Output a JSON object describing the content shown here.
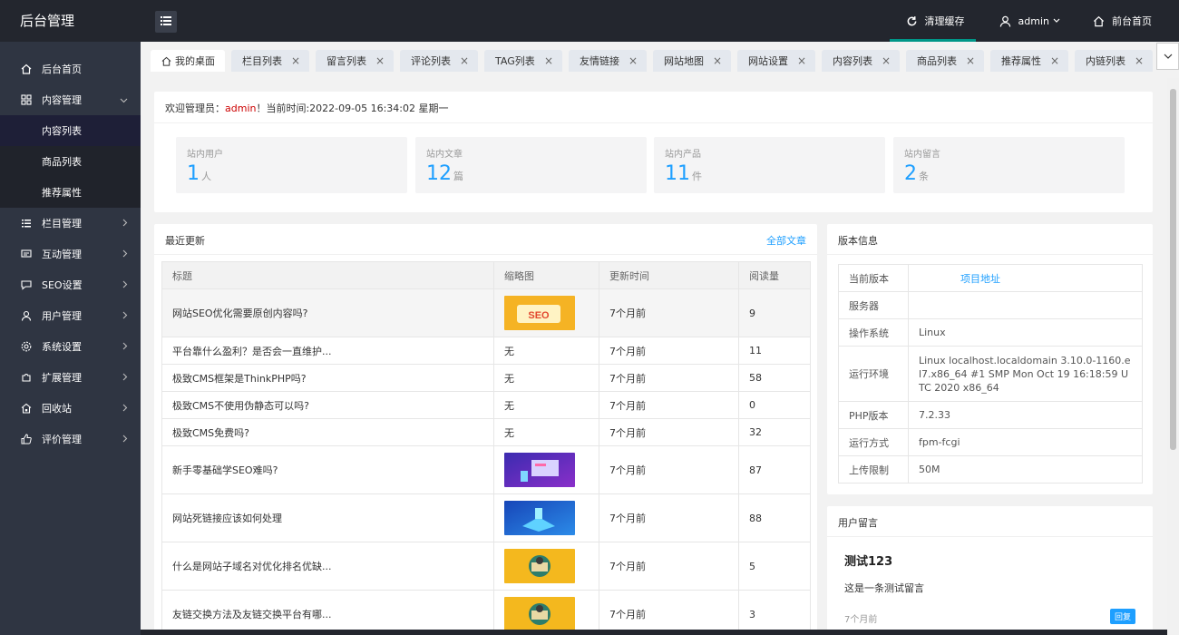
{
  "header": {
    "logo": "后台管理",
    "clear_cache": "清理缓存",
    "user": "admin",
    "front_home": "前台首页"
  },
  "sidebar": {
    "items": [
      {
        "label": "后台首页"
      },
      {
        "label": "内容管理"
      },
      {
        "label": "栏目管理"
      },
      {
        "label": "互动管理"
      },
      {
        "label": "SEO设置"
      },
      {
        "label": "用户管理"
      },
      {
        "label": "系统设置"
      },
      {
        "label": "扩展管理"
      },
      {
        "label": "回收站"
      },
      {
        "label": "评价管理"
      }
    ],
    "sub_items": [
      {
        "label": "内容列表"
      },
      {
        "label": "商品列表"
      },
      {
        "label": "推荐属性"
      }
    ]
  },
  "tabs": [
    {
      "label": "我的桌面"
    },
    {
      "label": "栏目列表"
    },
    {
      "label": "留言列表"
    },
    {
      "label": "评论列表"
    },
    {
      "label": "TAG列表"
    },
    {
      "label": "友情链接"
    },
    {
      "label": "网站地图"
    },
    {
      "label": "网站设置"
    },
    {
      "label": "内容列表"
    },
    {
      "label": "商品列表"
    },
    {
      "label": "推荐属性"
    },
    {
      "label": "内链列表"
    }
  ],
  "welcome": {
    "prefix": "欢迎管理员：",
    "admin": "admin",
    "suffix": "！当前时间:2022-09-05 16:34:02 星期一"
  },
  "stats": [
    {
      "label": "站内用户",
      "value": "1",
      "unit": "人"
    },
    {
      "label": "站内文章",
      "value": "12",
      "unit": "篇"
    },
    {
      "label": "站内产品",
      "value": "11",
      "unit": "件"
    },
    {
      "label": "站内留言",
      "value": "2",
      "unit": "条"
    }
  ],
  "recent": {
    "title": "最近更新",
    "all_link": "全部文章",
    "headers": [
      "标题",
      "缩略图",
      "更新时间",
      "阅读量"
    ],
    "rows": [
      {
        "title": "网站SEO优化需要原创内容吗?",
        "thumb": "",
        "time": "7个月前",
        "views": "9"
      },
      {
        "title": "平台靠什么盈利？是否会一直维护...",
        "thumb": "无",
        "time": "7个月前",
        "views": "11"
      },
      {
        "title": "极致CMS框架是ThinkPHP吗?",
        "thumb": "无",
        "time": "7个月前",
        "views": "58"
      },
      {
        "title": "极致CMS不使用伪静态可以吗?",
        "thumb": "无",
        "time": "7个月前",
        "views": "0"
      },
      {
        "title": "极致CMS免费吗?",
        "thumb": "无",
        "time": "7个月前",
        "views": "32"
      },
      {
        "title": "新手零基础学SEO难吗?",
        "thumb": "",
        "time": "7个月前",
        "views": "87"
      },
      {
        "title": "网站死链接应该如何处理",
        "thumb": "",
        "time": "7个月前",
        "views": "88"
      },
      {
        "title": "什么是网站子域名对优化排名优缺...",
        "thumb": "",
        "time": "7个月前",
        "views": "5"
      },
      {
        "title": "友链交换方法及友链交换平台有哪...",
        "thumb": "",
        "time": "7个月前",
        "views": "3"
      }
    ]
  },
  "version": {
    "title": "版本信息",
    "rows": [
      {
        "key": "当前版本",
        "value": "项目地址"
      },
      {
        "key": "服务器",
        "value": ""
      },
      {
        "key": "操作系统",
        "value": "Linux"
      },
      {
        "key": "运行环境",
        "value": "Linux localhost.localdomain 3.10.0-1160.el7.x86_64 #1 SMP Mon Oct 19 16:18:59 UTC 2020 x86_64"
      },
      {
        "key": "PHP版本",
        "value": "7.2.33"
      },
      {
        "key": "运行方式",
        "value": "fpm-fcgi"
      },
      {
        "key": "上传限制",
        "value": "50M"
      }
    ]
  },
  "messages": {
    "title": "用户留言",
    "msg_title": "测试123",
    "msg_body": "这是一条测试留言",
    "msg_time": "7个月前",
    "reply": "回复"
  }
}
